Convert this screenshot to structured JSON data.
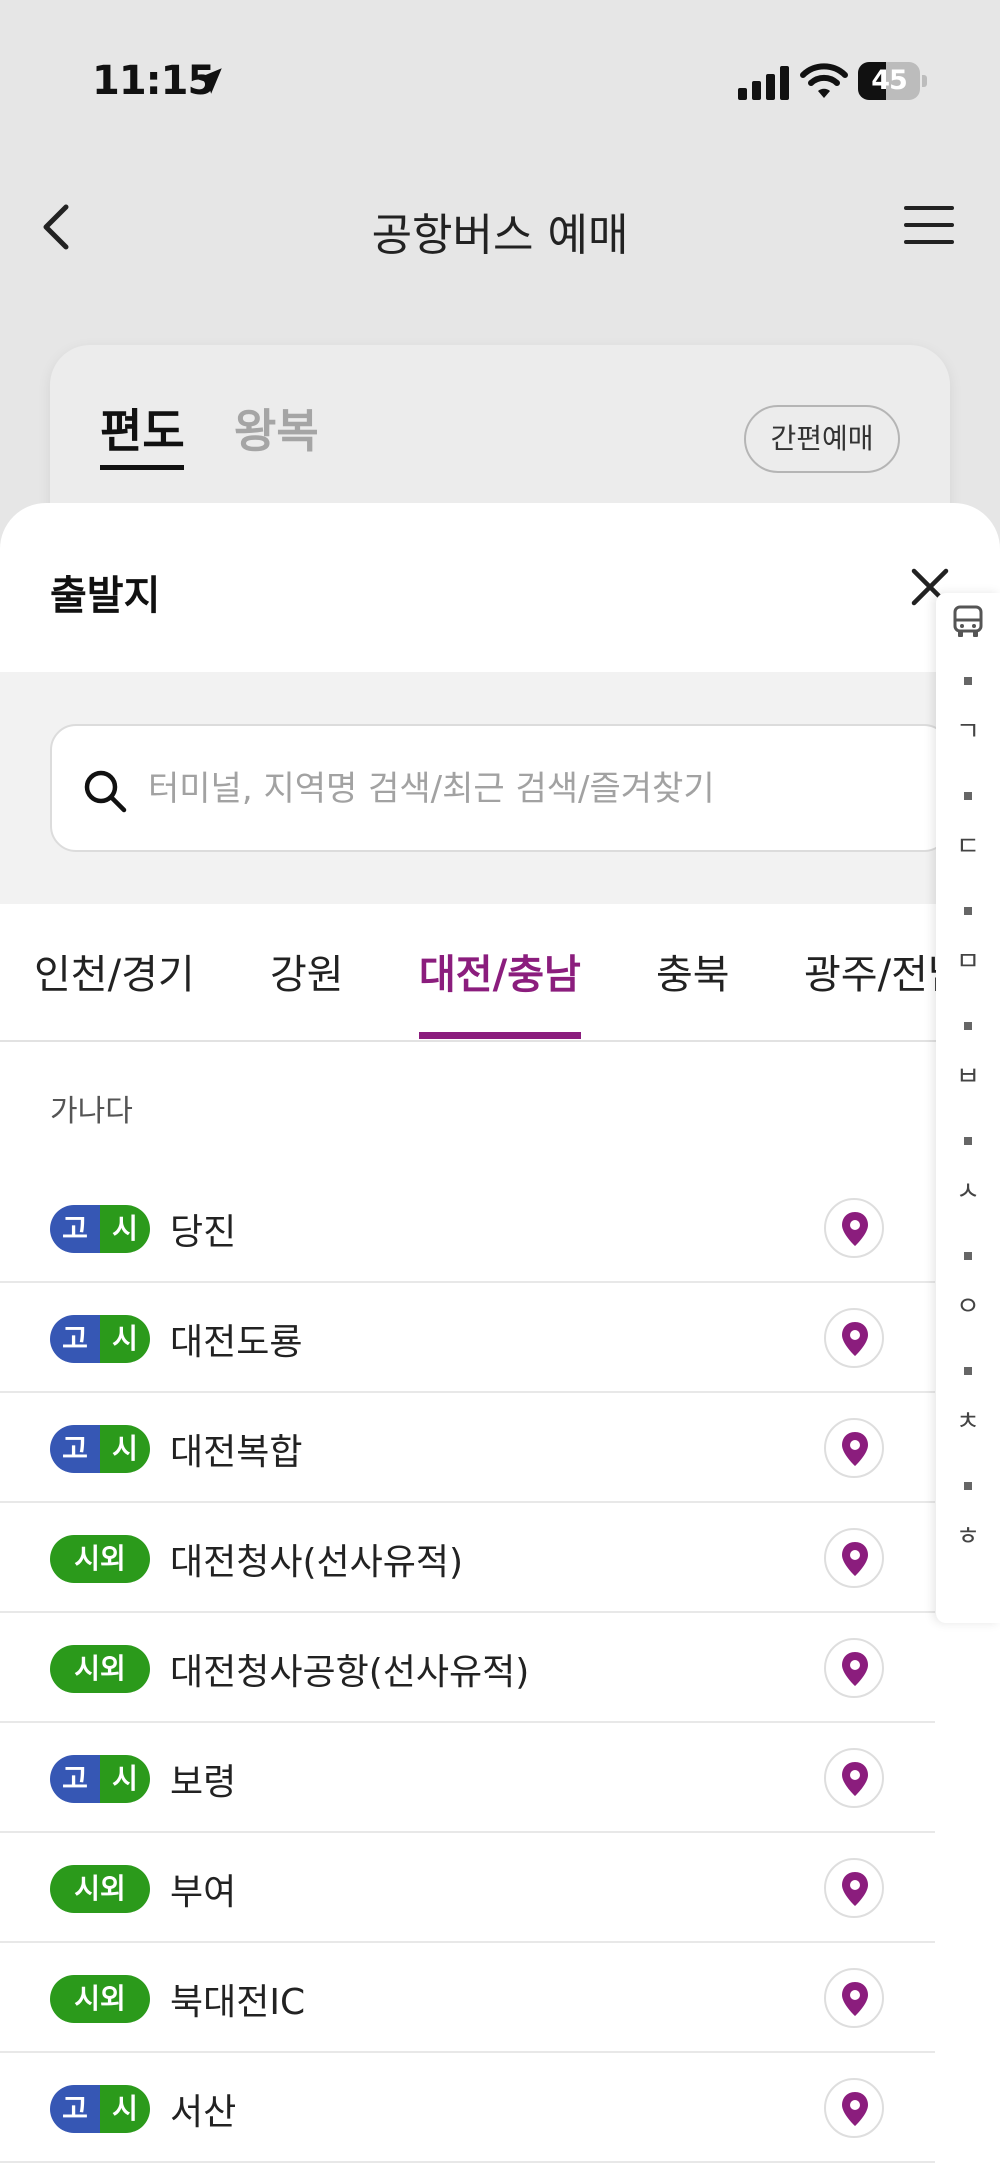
{
  "status_bar": {
    "time": "11:15",
    "battery": "45",
    "battery_level": 0.45
  },
  "header": {
    "title": "공항버스 예매"
  },
  "trip_card": {
    "tab_oneway": "편도",
    "tab_round": "왕복",
    "quick_button": "간편예매"
  },
  "sheet": {
    "title": "출발지",
    "search_placeholder": "터미널, 지역명 검색/최근 검색/즐겨찾기",
    "region_tabs": [
      {
        "label": "인천/경기",
        "active": false
      },
      {
        "label": "강원",
        "active": false
      },
      {
        "label": "대전/충남",
        "active": true
      },
      {
        "label": "충북",
        "active": false
      },
      {
        "label": "광주/전남",
        "active": false
      }
    ],
    "section_label": "가나다",
    "terminals": [
      {
        "type": "split",
        "badge_left": "고",
        "badge_right": "시",
        "name": "당진"
      },
      {
        "type": "split",
        "badge_left": "고",
        "badge_right": "시",
        "name": "대전도룡"
      },
      {
        "type": "split",
        "badge_left": "고",
        "badge_right": "시",
        "name": "대전복합"
      },
      {
        "type": "full",
        "badge": "시외",
        "name": "대전청사(선사유적)"
      },
      {
        "type": "full",
        "badge": "시외",
        "name": "대전청사공항(선사유적)"
      },
      {
        "type": "split",
        "badge_left": "고",
        "badge_right": "시",
        "name": "보령"
      },
      {
        "type": "full",
        "badge": "시외",
        "name": "부여"
      },
      {
        "type": "full",
        "badge": "시외",
        "name": "북대전IC"
      },
      {
        "type": "split",
        "badge_left": "고",
        "badge_right": "시",
        "name": "서산"
      }
    ],
    "index_items": [
      "bus-icon",
      "ㄱ",
      "ㄷ",
      "ㅁ",
      "ㅂ",
      "ㅅ",
      "ㅇ",
      "ㅊ",
      "ㅎ"
    ]
  },
  "colors": {
    "accent": "#8b1d7d",
    "express_blue": "#3657b4",
    "intercity_green": "#2b9a1b"
  }
}
